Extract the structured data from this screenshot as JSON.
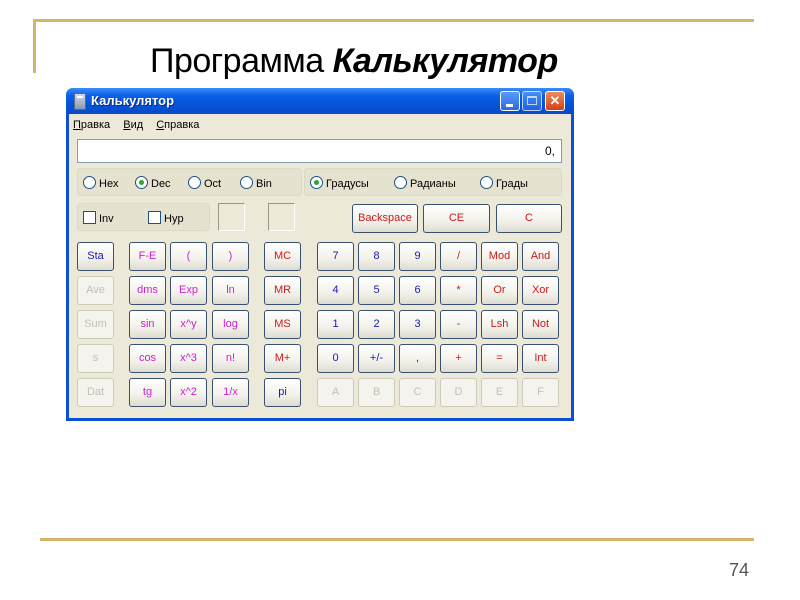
{
  "slide": {
    "title_regular": "Программа",
    "title_bold": "Калькулятор",
    "page_number": "74",
    "accent_color": "#d4b46a"
  },
  "window": {
    "title": "Калькулятор",
    "icon": "calculator-icon",
    "controls": [
      "minimize-icon",
      "maximize-icon",
      "close-icon"
    ],
    "close_symbol": "✕"
  },
  "menu": {
    "items": [
      {
        "first": "П",
        "rest": "равка"
      },
      {
        "first": "В",
        "rest": "ид"
      },
      {
        "first": "С",
        "rest": "правка"
      }
    ]
  },
  "display": {
    "value": "0,"
  },
  "number_system": {
    "options": [
      "Hex",
      "Dec",
      "Oct",
      "Bin"
    ],
    "selected": "Dec"
  },
  "angle_units": {
    "options": [
      "Градусы",
      "Радианы",
      "Грады"
    ],
    "selected": "Градусы"
  },
  "checkboxes": [
    {
      "label": "Inv",
      "checked": false
    },
    {
      "label": "Hyp",
      "checked": false
    }
  ],
  "edit_buttons": [
    "Backspace",
    "CE",
    "C"
  ],
  "stat_buttons": [
    {
      "label": "Sta",
      "enabled": true
    },
    {
      "label": "Ave",
      "enabled": false
    },
    {
      "label": "Sum",
      "enabled": false
    },
    {
      "label": "s",
      "enabled": false
    },
    {
      "label": "Dat",
      "enabled": false
    }
  ],
  "sci_buttons": [
    [
      "F-E",
      "(",
      ")"
    ],
    [
      "dms",
      "Exp",
      "ln"
    ],
    [
      "sin",
      "x^y",
      "log"
    ],
    [
      "cos",
      "x^3",
      "n!"
    ],
    [
      "tg",
      "x^2",
      "1/x"
    ]
  ],
  "memory_buttons": [
    "MC",
    "MR",
    "MS",
    "M+",
    "pi"
  ],
  "keypad": [
    [
      "7",
      "8",
      "9",
      "/",
      "Mod",
      "And"
    ],
    [
      "4",
      "5",
      "6",
      "*",
      "Or",
      "Xor"
    ],
    [
      "1",
      "2",
      "3",
      "-",
      "Lsh",
      "Not"
    ],
    [
      "0",
      "+/-",
      ",",
      "+",
      "=",
      "Int"
    ],
    [
      "A",
      "B",
      "C",
      "D",
      "E",
      "F"
    ]
  ],
  "colors": {
    "digit": "#1a1ab0",
    "function": "#d01ed0",
    "operator": "#cc1a1a",
    "disabled": "#c2bfb2",
    "titlebar": "#0552d6",
    "window_bg": "#ece9d8"
  }
}
